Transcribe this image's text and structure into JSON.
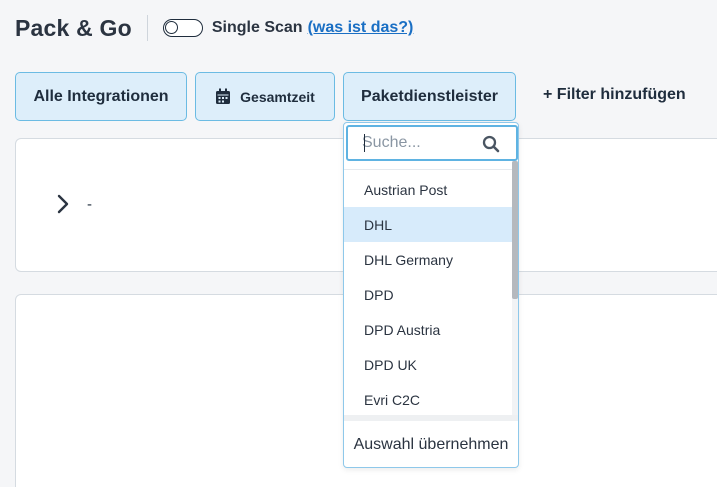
{
  "header": {
    "title": "Pack & Go",
    "toggle_label": "Single Scan",
    "help_link": "(was ist das?)"
  },
  "filters": {
    "integrations_label": "Alle Integrationen",
    "time_label": "Gesamtzeit",
    "carrier_label": "Paketdienstleister",
    "add_filter_label": "+ Filter hinzufügen"
  },
  "results": {
    "row_value": "-"
  },
  "dropdown": {
    "search_placeholder": "Suche...",
    "items": [
      {
        "label": "Austrian Post",
        "selected": false
      },
      {
        "label": "DHL",
        "selected": true
      },
      {
        "label": "DHL Germany",
        "selected": false
      },
      {
        "label": "DPD",
        "selected": false
      },
      {
        "label": "DPD Austria",
        "selected": false
      },
      {
        "label": "DPD UK",
        "selected": false
      },
      {
        "label": "Evri C2C",
        "selected": false
      }
    ],
    "apply_label": "Auswahl übernehmen"
  },
  "single_scan_enabled": false,
  "colors": {
    "accent": "#1a6fc4",
    "button_bg": "#ddeefa",
    "button_border": "#6bbbe3",
    "selected_row": "#d7ebfb"
  },
  "icons": {
    "time_button": "calendar-icon",
    "search": "search-icon",
    "row_expand": "chevron-right-icon"
  }
}
